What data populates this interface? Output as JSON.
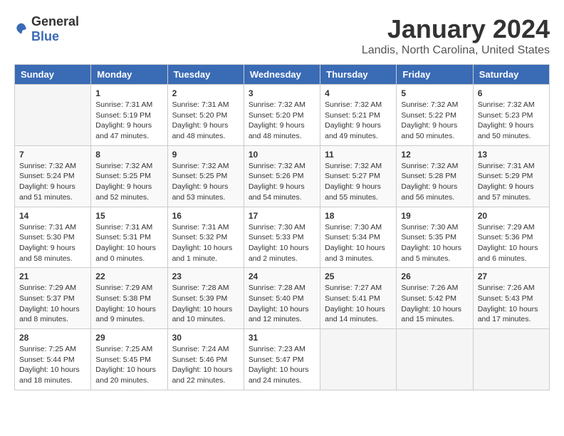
{
  "logo": {
    "general": "General",
    "blue": "Blue"
  },
  "title": "January 2024",
  "subtitle": "Landis, North Carolina, United States",
  "headers": [
    "Sunday",
    "Monday",
    "Tuesday",
    "Wednesday",
    "Thursday",
    "Friday",
    "Saturday"
  ],
  "weeks": [
    [
      {
        "day": "",
        "info": ""
      },
      {
        "day": "1",
        "info": "Sunrise: 7:31 AM\nSunset: 5:19 PM\nDaylight: 9 hours\nand 47 minutes."
      },
      {
        "day": "2",
        "info": "Sunrise: 7:31 AM\nSunset: 5:20 PM\nDaylight: 9 hours\nand 48 minutes."
      },
      {
        "day": "3",
        "info": "Sunrise: 7:32 AM\nSunset: 5:20 PM\nDaylight: 9 hours\nand 48 minutes."
      },
      {
        "day": "4",
        "info": "Sunrise: 7:32 AM\nSunset: 5:21 PM\nDaylight: 9 hours\nand 49 minutes."
      },
      {
        "day": "5",
        "info": "Sunrise: 7:32 AM\nSunset: 5:22 PM\nDaylight: 9 hours\nand 50 minutes."
      },
      {
        "day": "6",
        "info": "Sunrise: 7:32 AM\nSunset: 5:23 PM\nDaylight: 9 hours\nand 50 minutes."
      }
    ],
    [
      {
        "day": "7",
        "info": "Sunrise: 7:32 AM\nSunset: 5:24 PM\nDaylight: 9 hours\nand 51 minutes."
      },
      {
        "day": "8",
        "info": "Sunrise: 7:32 AM\nSunset: 5:25 PM\nDaylight: 9 hours\nand 52 minutes."
      },
      {
        "day": "9",
        "info": "Sunrise: 7:32 AM\nSunset: 5:25 PM\nDaylight: 9 hours\nand 53 minutes."
      },
      {
        "day": "10",
        "info": "Sunrise: 7:32 AM\nSunset: 5:26 PM\nDaylight: 9 hours\nand 54 minutes."
      },
      {
        "day": "11",
        "info": "Sunrise: 7:32 AM\nSunset: 5:27 PM\nDaylight: 9 hours\nand 55 minutes."
      },
      {
        "day": "12",
        "info": "Sunrise: 7:32 AM\nSunset: 5:28 PM\nDaylight: 9 hours\nand 56 minutes."
      },
      {
        "day": "13",
        "info": "Sunrise: 7:31 AM\nSunset: 5:29 PM\nDaylight: 9 hours\nand 57 minutes."
      }
    ],
    [
      {
        "day": "14",
        "info": "Sunrise: 7:31 AM\nSunset: 5:30 PM\nDaylight: 9 hours\nand 58 minutes."
      },
      {
        "day": "15",
        "info": "Sunrise: 7:31 AM\nSunset: 5:31 PM\nDaylight: 10 hours\nand 0 minutes."
      },
      {
        "day": "16",
        "info": "Sunrise: 7:31 AM\nSunset: 5:32 PM\nDaylight: 10 hours\nand 1 minute."
      },
      {
        "day": "17",
        "info": "Sunrise: 7:30 AM\nSunset: 5:33 PM\nDaylight: 10 hours\nand 2 minutes."
      },
      {
        "day": "18",
        "info": "Sunrise: 7:30 AM\nSunset: 5:34 PM\nDaylight: 10 hours\nand 3 minutes."
      },
      {
        "day": "19",
        "info": "Sunrise: 7:30 AM\nSunset: 5:35 PM\nDaylight: 10 hours\nand 5 minutes."
      },
      {
        "day": "20",
        "info": "Sunrise: 7:29 AM\nSunset: 5:36 PM\nDaylight: 10 hours\nand 6 minutes."
      }
    ],
    [
      {
        "day": "21",
        "info": "Sunrise: 7:29 AM\nSunset: 5:37 PM\nDaylight: 10 hours\nand 8 minutes."
      },
      {
        "day": "22",
        "info": "Sunrise: 7:29 AM\nSunset: 5:38 PM\nDaylight: 10 hours\nand 9 minutes."
      },
      {
        "day": "23",
        "info": "Sunrise: 7:28 AM\nSunset: 5:39 PM\nDaylight: 10 hours\nand 10 minutes."
      },
      {
        "day": "24",
        "info": "Sunrise: 7:28 AM\nSunset: 5:40 PM\nDaylight: 10 hours\nand 12 minutes."
      },
      {
        "day": "25",
        "info": "Sunrise: 7:27 AM\nSunset: 5:41 PM\nDaylight: 10 hours\nand 14 minutes."
      },
      {
        "day": "26",
        "info": "Sunrise: 7:26 AM\nSunset: 5:42 PM\nDaylight: 10 hours\nand 15 minutes."
      },
      {
        "day": "27",
        "info": "Sunrise: 7:26 AM\nSunset: 5:43 PM\nDaylight: 10 hours\nand 17 minutes."
      }
    ],
    [
      {
        "day": "28",
        "info": "Sunrise: 7:25 AM\nSunset: 5:44 PM\nDaylight: 10 hours\nand 18 minutes."
      },
      {
        "day": "29",
        "info": "Sunrise: 7:25 AM\nSunset: 5:45 PM\nDaylight: 10 hours\nand 20 minutes."
      },
      {
        "day": "30",
        "info": "Sunrise: 7:24 AM\nSunset: 5:46 PM\nDaylight: 10 hours\nand 22 minutes."
      },
      {
        "day": "31",
        "info": "Sunrise: 7:23 AM\nSunset: 5:47 PM\nDaylight: 10 hours\nand 24 minutes."
      },
      {
        "day": "",
        "info": ""
      },
      {
        "day": "",
        "info": ""
      },
      {
        "day": "",
        "info": ""
      }
    ]
  ]
}
